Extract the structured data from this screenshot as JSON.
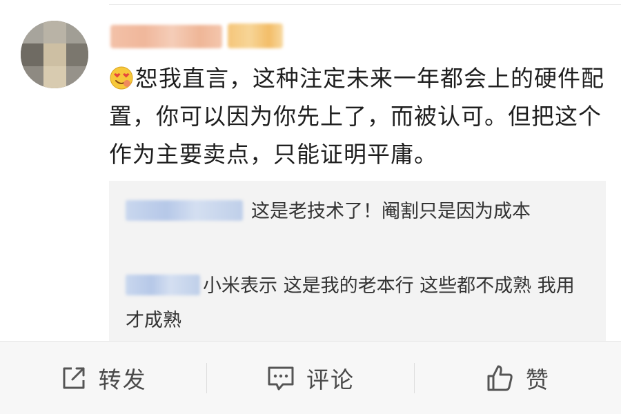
{
  "post": {
    "text": "恕我直言，这种注定未来一年都会上的硬件配置，你可以因为你先上了，而被认可。但把这个作为主要卖点，只能证明平庸。",
    "emoji": "heart-eyes-face-icon"
  },
  "replies": [
    {
      "text": "这是老技术了！阉割只是因为成本"
    },
    {
      "text": "小米表示 这是我的老本行 这些都不成熟 我用才成熟"
    }
  ],
  "actions": {
    "repost_label": "转发",
    "comment_label": "评论",
    "like_label": "赞"
  },
  "colors": {
    "text": "#1f1f1f",
    "reply_bg": "#f3f3f3",
    "action_bar_bg": "#f7f7f7",
    "action_text": "#4a4a4a"
  }
}
